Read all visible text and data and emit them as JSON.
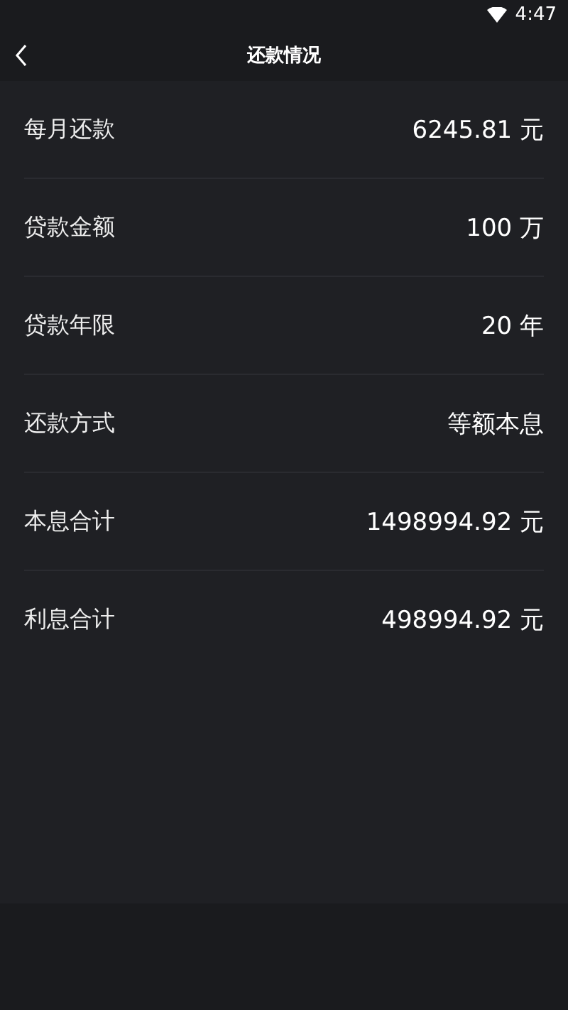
{
  "status_bar": {
    "time": "4:47"
  },
  "toolbar": {
    "title": "还款情况"
  },
  "rows": [
    {
      "label": "每月还款",
      "value": "6245.81 元"
    },
    {
      "label": "贷款金额",
      "value": "100 万"
    },
    {
      "label": "贷款年限",
      "value": "20 年"
    },
    {
      "label": "还款方式",
      "value": "等额本息"
    },
    {
      "label": "本息合计",
      "value": "1498994.92 元"
    },
    {
      "label": "利息合计",
      "value": "498994.92 元"
    }
  ]
}
